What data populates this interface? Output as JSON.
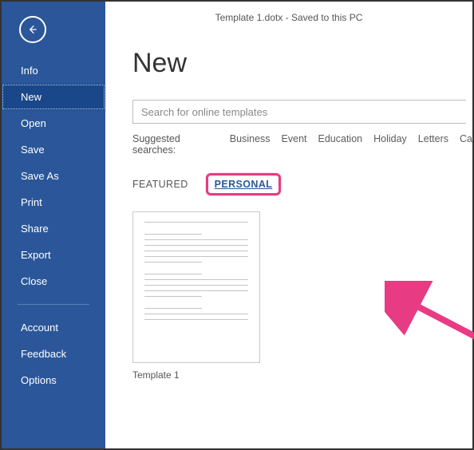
{
  "titlebar": {
    "text": "Template 1.dotx - Saved to this PC"
  },
  "sidebar": {
    "items": [
      {
        "label": "Info",
        "active": false
      },
      {
        "label": "New",
        "active": true
      },
      {
        "label": "Open",
        "active": false
      },
      {
        "label": "Save",
        "active": false
      },
      {
        "label": "Save As",
        "active": false
      },
      {
        "label": "Print",
        "active": false
      },
      {
        "label": "Share",
        "active": false
      },
      {
        "label": "Export",
        "active": false
      },
      {
        "label": "Close",
        "active": false
      }
    ],
    "bottom_items": [
      {
        "label": "Account"
      },
      {
        "label": "Feedback"
      },
      {
        "label": "Options"
      }
    ]
  },
  "main": {
    "heading": "New",
    "search_placeholder": "Search for online templates",
    "suggested_label": "Suggested searches:",
    "suggested": [
      "Business",
      "Event",
      "Education",
      "Holiday",
      "Letters",
      "Ca"
    ],
    "tabs": {
      "featured": "FEATURED",
      "personal": "PERSONAL"
    },
    "templates": [
      {
        "name": "Template 1"
      }
    ]
  },
  "colors": {
    "brand": "#2b579a",
    "annotation": "#e73b84"
  }
}
